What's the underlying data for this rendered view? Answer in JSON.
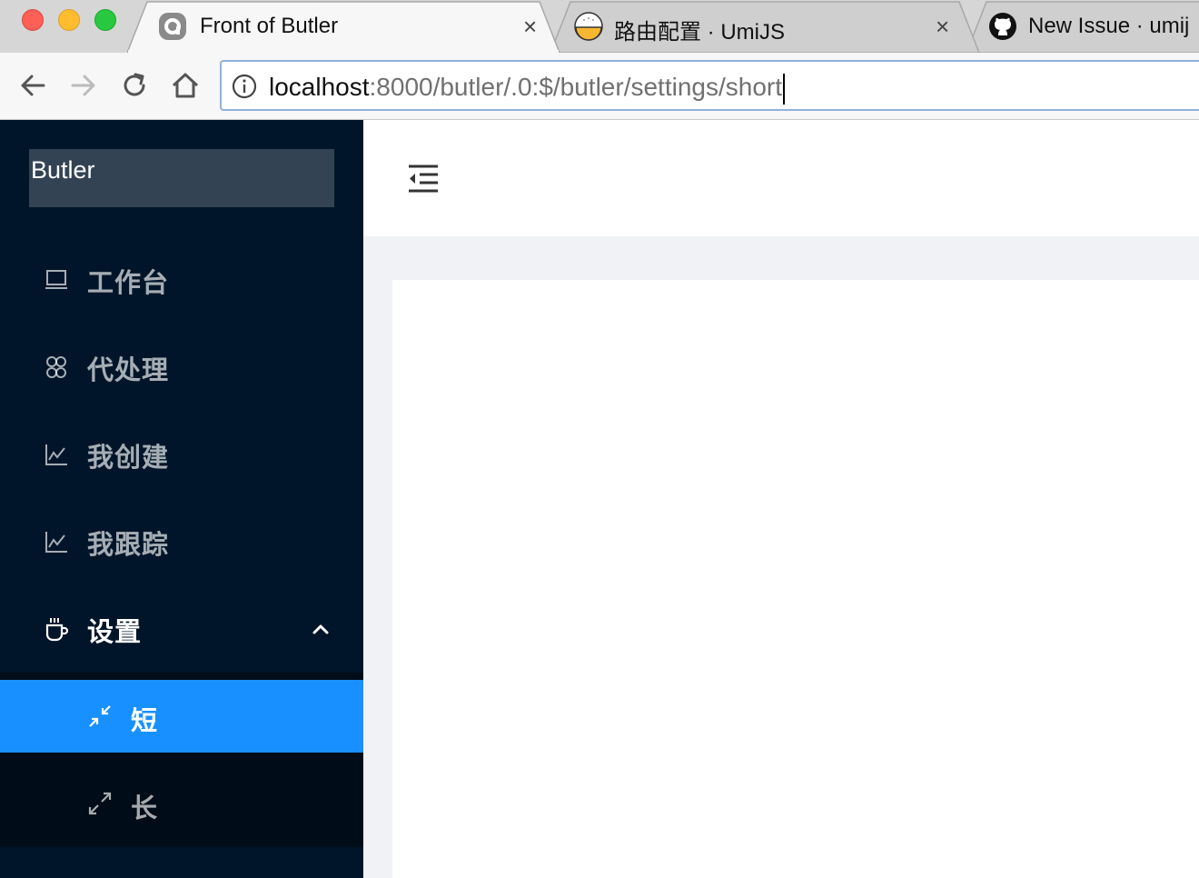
{
  "browser": {
    "tabs": [
      {
        "title": "Front of Butler",
        "favicon": "umi-logo-icon",
        "active": true
      },
      {
        "title": "路由配置 · UmiJS",
        "favicon": "umi-rice-icon",
        "active": false
      },
      {
        "title": "New Issue · umij",
        "favicon": "github-icon",
        "active": false
      }
    ],
    "close_glyph": "×",
    "url_host": "localhost",
    "url_path": ":8000/butler/.0:$/butler/settings/short"
  },
  "app": {
    "logo_text": "Butler",
    "menu": [
      {
        "label": "工作台",
        "icon": "laptop-icon"
      },
      {
        "label": "代处理",
        "icon": "team-icon"
      },
      {
        "label": "我创建",
        "icon": "line-chart-icon"
      },
      {
        "label": "我跟踪",
        "icon": "line-chart-icon"
      },
      {
        "label": "设置",
        "icon": "coffee-icon",
        "open": true
      }
    ],
    "submenu": [
      {
        "label": "短",
        "icon": "shrink-icon",
        "selected": true
      },
      {
        "label": "长",
        "icon": "arrows-alt-icon",
        "selected": false
      }
    ]
  },
  "colors": {
    "sider_bg": "#001529",
    "submenu_bg": "#000c17",
    "selected": "#1890ff",
    "layout_bg": "#f0f2f5"
  }
}
